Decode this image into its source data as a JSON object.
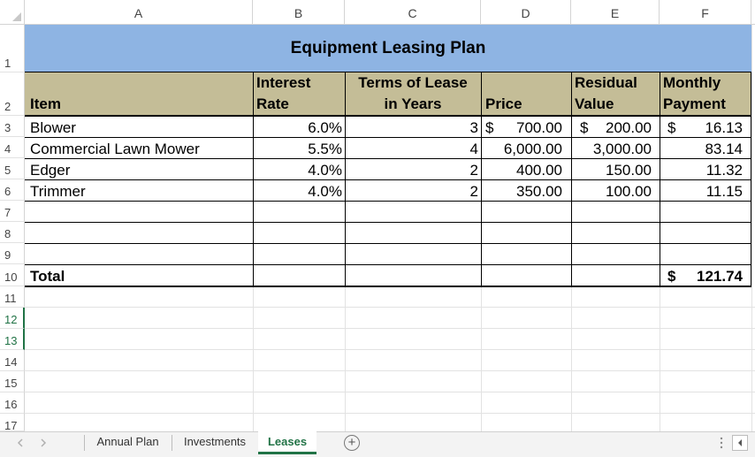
{
  "columns": [
    "A",
    "B",
    "C",
    "D",
    "E",
    "F"
  ],
  "rows": [
    "1",
    "2",
    "3",
    "4",
    "5",
    "6",
    "7",
    "8",
    "9",
    "10",
    "11",
    "12",
    "13",
    "14",
    "15",
    "16",
    "17"
  ],
  "sheet": {
    "title": "Equipment Leasing Plan",
    "headers": {
      "item": "Item",
      "interest_1": "Interest",
      "interest_2": "Rate",
      "terms_1": "Terms of Lease",
      "terms_2": "in Years",
      "price": "Price",
      "residual_1": "Residual",
      "residual_2": "Value",
      "monthly_1": "Monthly",
      "monthly_2": "Payment"
    },
    "data_rows": [
      {
        "item": "Blower",
        "rate": "6.0%",
        "years": "3",
        "price_sym": "$",
        "price": "700.00",
        "res_sym": "$",
        "residual": "200.00",
        "pay_sym": "$",
        "payment": "16.13"
      },
      {
        "item": "Commercial Lawn Mower",
        "rate": "5.5%",
        "years": "4",
        "price_sym": "",
        "price": "6,000.00",
        "res_sym": "",
        "residual": "3,000.00",
        "pay_sym": "",
        "payment": "83.14"
      },
      {
        "item": "Edger",
        "rate": "4.0%",
        "years": "2",
        "price_sym": "",
        "price": "400.00",
        "res_sym": "",
        "residual": "150.00",
        "pay_sym": "",
        "payment": "11.32"
      },
      {
        "item": "Trimmer",
        "rate": "4.0%",
        "years": "2",
        "price_sym": "",
        "price": "350.00",
        "res_sym": "",
        "residual": "100.00",
        "pay_sym": "",
        "payment": "11.15"
      }
    ],
    "total_label": "Total",
    "total_sym": "$",
    "total_value": "121.74"
  },
  "tabs": {
    "annual": "Annual Plan",
    "investments": "Investments",
    "leases": "Leases",
    "add": "+"
  },
  "icons": {
    "prev": "scroll-left-icon",
    "next": "scroll-right-icon",
    "add": "add-sheet-icon",
    "more": "more-options-icon",
    "hscroll_left": "hscroll-left-icon"
  },
  "colors": {
    "title_band": "#8eb4e3",
    "header_band": "#c4bd97",
    "accent": "#217346"
  }
}
